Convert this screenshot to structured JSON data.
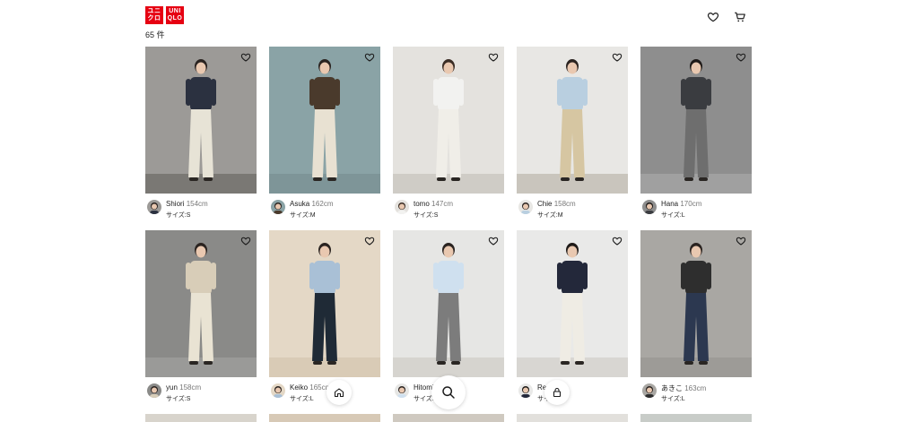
{
  "header": {
    "logo_rows_1": [
      "ユニ",
      "クロ"
    ],
    "logo_rows_2": [
      "UNI",
      "QLO"
    ],
    "icons": [
      "heart-icon",
      "cart-icon"
    ]
  },
  "count_label": "65 件",
  "colors": {
    "brand": "#e60012"
  },
  "cards": [
    {
      "name": "Shiori",
      "height": "154cm",
      "size": "サイズ:S",
      "bg": "#9c9a97",
      "floor": "#7a7874",
      "top": "#2b3140",
      "bottom": "#e7e3d6",
      "hair": "#2a2320"
    },
    {
      "name": "Asuka",
      "height": "162cm",
      "size": "サイズ:M",
      "bg": "#8aa3a6",
      "floor": "#7e9598",
      "top": "#4a3a2c",
      "bottom": "#e8e1d2",
      "hair": "#2a2320"
    },
    {
      "name": "tomo",
      "height": "147cm",
      "size": "サイズ:S",
      "bg": "#e4e2de",
      "floor": "#cfccc6",
      "top": "#f2f2f0",
      "bottom": "#f0eee8",
      "hair": "#3a2c24"
    },
    {
      "name": "Chie",
      "height": "158cm",
      "size": "サイズ:M",
      "bg": "#e8e7e4",
      "floor": "#c9c5bd",
      "top": "#b9cfe0",
      "bottom": "#d6c6a2",
      "hair": "#2a2320"
    },
    {
      "name": "Hana",
      "height": "170cm",
      "size": "サイズ:L",
      "bg": "#8e8e8e",
      "floor": "#a0a0a0",
      "top": "#3a3c40",
      "bottom": "#6e6e6e",
      "hair": "#1e1a18"
    },
    {
      "name": "yun",
      "height": "158cm",
      "size": "サイズ:S",
      "bg": "#8a8a88",
      "floor": "#9a9a98",
      "top": "#d8cdb8",
      "bottom": "#e9e3d3",
      "hair": "#2a2320"
    },
    {
      "name": "Keiko",
      "height": "165cm",
      "size": "サイズ:L",
      "bg": "#e4d8c6",
      "floor": "#d9cbb6",
      "top": "#a9c0d6",
      "bottom": "#1f2a36",
      "hair": "#2a2320"
    },
    {
      "name": "Hitomi",
      "height": "",
      "size": "サイズ:S",
      "bg": "#e6e6e4",
      "floor": "#d6d4cf",
      "top": "#cfe0ef",
      "bottom": "#7c7c7c",
      "hair": "#2a2320"
    },
    {
      "name": "Re",
      "height": "",
      "size": "サイズ:M",
      "bg": "#e9e9e8",
      "floor": "#d8d6d2",
      "top": "#23283a",
      "bottom": "#efece4",
      "hair": "#1e1a18"
    },
    {
      "name": "あきこ",
      "height": "163cm",
      "size": "サイズ:L",
      "bg": "#a9a7a3",
      "floor": "#9d9b97",
      "top": "#2e2e2e",
      "bottom": "#2c3850",
      "hair": "#2a2320"
    }
  ],
  "peek_row_bgs": [
    "#d8d4cc",
    "#d7c9b6",
    "#cfc9c0",
    "#e2e0dc",
    "#c8ccc8"
  ],
  "nav": {
    "home": "home-icon",
    "search": "search-icon",
    "account": "account-icon"
  }
}
